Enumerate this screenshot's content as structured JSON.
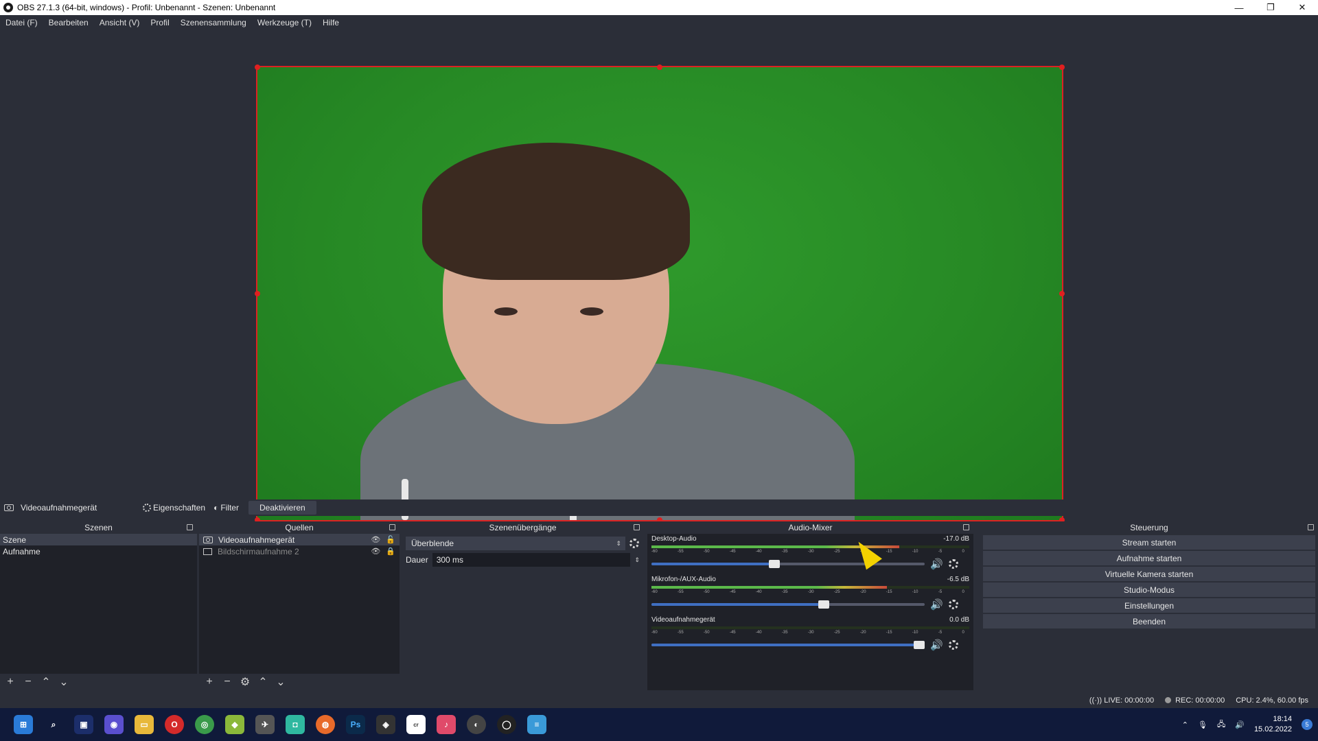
{
  "window": {
    "title": "OBS 27.1.3 (64-bit, windows) - Profil: Unbenannt - Szenen: Unbenannt",
    "minimize": "—",
    "maximize": "❐",
    "close": "✕"
  },
  "menu": [
    "Datei (F)",
    "Bearbeiten",
    "Ansicht (V)",
    "Profil",
    "Szenensammlung",
    "Werkzeuge (T)",
    "Hilfe"
  ],
  "source_toolbar": {
    "source_name": "Videoaufnahmegerät",
    "properties": "Eigenschaften",
    "filter": "Filter",
    "deactivate": "Deaktivieren"
  },
  "scenes": {
    "title": "Szenen",
    "items": [
      "Szene",
      "Aufnahme"
    ]
  },
  "sources": {
    "title": "Quellen",
    "items": [
      "Videoaufnahmegerät",
      "Bildschirmaufnahme 2"
    ]
  },
  "transitions": {
    "title": "Szenenübergänge",
    "selected": "Überblende",
    "duration_label": "Dauer",
    "duration_value": "300 ms"
  },
  "mixer": {
    "title": "Audio-Mixer",
    "ticks": [
      "-60",
      "-55",
      "-50",
      "-45",
      "-40",
      "-35",
      "-30",
      "-25",
      "-20",
      "-15",
      "-10",
      "-5",
      "0"
    ],
    "channels": [
      {
        "name": "Desktop-Audio",
        "db": "-17.0 dB",
        "level": 0.78,
        "volume": 0.45
      },
      {
        "name": "Mikrofon-/AUX-Audio",
        "db": "-6.5 dB",
        "level": 0.74,
        "volume": 0.63
      },
      {
        "name": "Videoaufnahmegerät",
        "db": "0.0 dB",
        "level": 0.0,
        "volume": 0.98
      }
    ]
  },
  "controls": {
    "title": "Steuerung",
    "buttons": [
      "Stream starten",
      "Aufnahme starten",
      "Virtuelle Kamera starten",
      "Studio-Modus",
      "Einstellungen",
      "Beenden"
    ]
  },
  "status": {
    "live": "LIVE: 00:00:00",
    "rec": "REC: 00:00:00",
    "cpu": "CPU: 2.4%, 60.00 fps"
  },
  "taskbar": {
    "time": "18:14",
    "date": "15.02.2022",
    "notifications": "5"
  },
  "colors": {
    "panel_bg": "#2b2e38",
    "dock_bg": "#1f2128",
    "selection_border": "#dd2222",
    "green_screen": "#2b8f28"
  }
}
